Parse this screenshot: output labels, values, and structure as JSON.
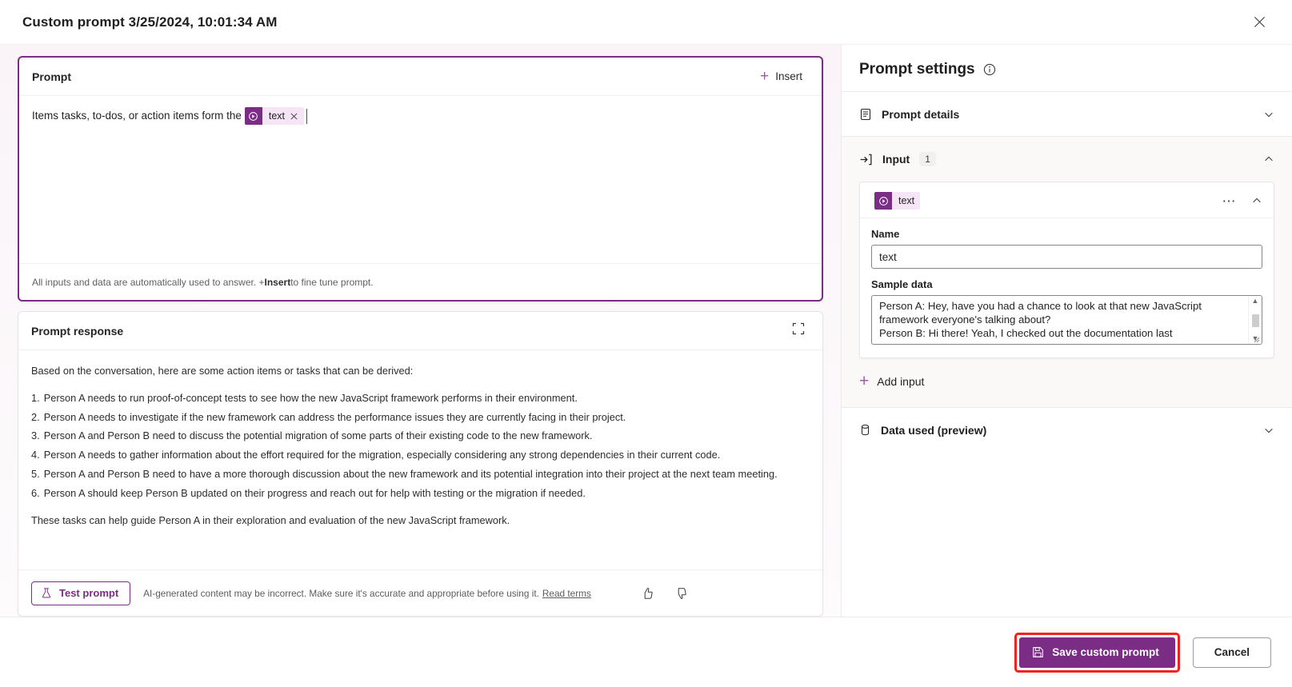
{
  "window": {
    "title": "Custom prompt 3/25/2024, 10:01:34 AM",
    "close_icon": "close-icon"
  },
  "prompt_card": {
    "header_label": "Prompt",
    "insert_label": "Insert",
    "insert_icon": "plus-icon",
    "text_before_token": "Items tasks, to-dos, or action items form the",
    "token": {
      "label": "text",
      "icon": "copilot-token-icon",
      "remove_icon": "close-icon"
    },
    "footer_prefix": "All inputs and data are automatically used to answer. + ",
    "footer_bold": "Insert",
    "footer_suffix": " to fine tune prompt."
  },
  "response_card": {
    "header_label": "Prompt response",
    "expand_icon": "expand-icon",
    "intro": "Based on the conversation, here are some action items or tasks that can be derived:",
    "items": [
      {
        "num": "1.",
        "text": "Person A needs to run proof-of-concept tests to see how the new JavaScript framework performs in their environment."
      },
      {
        "num": "2.",
        "text": "Person A needs to investigate if the new framework can address the performance issues they are currently facing in their project."
      },
      {
        "num": "3.",
        "text": "Person A and Person B need to discuss the potential migration of some parts of their existing code to the new framework."
      },
      {
        "num": "4.",
        "text": "Person A needs to gather information about the effort required for the migration, especially considering any strong dependencies in their current code."
      },
      {
        "num": "5.",
        "text": "Person A and Person B need to have a more thorough discussion about the new framework and its potential integration into their project at the next team meeting."
      },
      {
        "num": "6.",
        "text": "Person A should keep Person B updated on their progress and reach out for help with testing or the migration if needed."
      }
    ],
    "outro": "These tasks can help guide Person A in their exploration and evaluation of the new JavaScript framework.",
    "test_button": "Test prompt",
    "test_icon": "flask-icon",
    "disclaimer": "AI-generated content may be incorrect. Make sure it's accurate and appropriate before using it.",
    "terms_link": "Read terms",
    "thumb_up_icon": "thumb-up-icon",
    "thumb_down_icon": "thumb-down-icon"
  },
  "settings": {
    "title": "Prompt settings",
    "info_icon": "info-icon",
    "prompt_details": {
      "label": "Prompt details",
      "icon": "document-icon",
      "chevron": "chevron-down-icon"
    },
    "input_section": {
      "label": "Input",
      "count": "1",
      "icon": "arrow-into-box-icon",
      "chevron": "chevron-up-icon"
    },
    "input_card": {
      "chip_label": "text",
      "chip_icon": "copilot-token-icon",
      "overflow_icon": "more-options-icon",
      "chevron": "chevron-up-icon",
      "name_label": "Name",
      "name_value": "text",
      "sample_label": "Sample data",
      "sample_value": "Person A: Hey, have you had a chance to look at that new JavaScript framework everyone's talking about?\nPerson B: Hi there! Yeah, I checked out the documentation last"
    },
    "add_input": {
      "label": "Add input",
      "icon": "plus-icon"
    },
    "data_used": {
      "label": "Data used (preview)",
      "icon": "database-icon",
      "chevron": "chevron-down-icon"
    }
  },
  "footer": {
    "save_label": "Save custom prompt",
    "save_icon": "save-icon",
    "cancel_label": "Cancel",
    "highlight_color": "#ef2222",
    "accent_color": "#7b2c85"
  }
}
